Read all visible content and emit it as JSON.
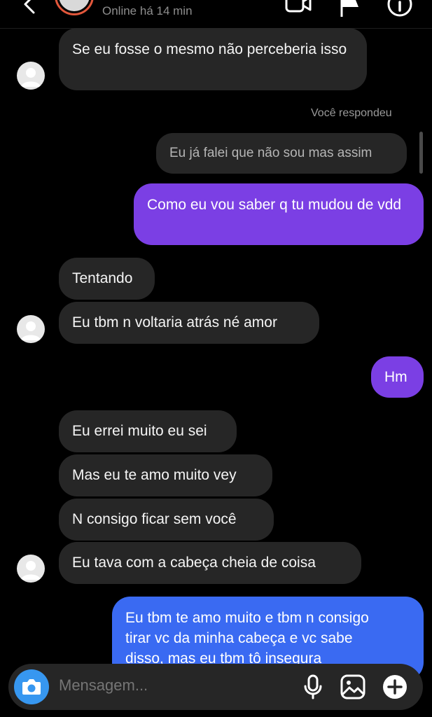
{
  "header": {
    "status": "Online há 14 min"
  },
  "messages": {
    "m1": "Se eu fosse o mesmo não perceberia isso",
    "reply_label": "Você respondeu",
    "reply_quote": "Eu já falei que não sou mas assim",
    "m2": "Como eu vou saber q tu mudou de vdd",
    "m3": "Tentando",
    "m4": "Eu tbm n voltaria atrás né amor",
    "m5": "Hm",
    "m6": "Eu errei muito eu sei",
    "m7": "Mas eu te amo muito vey",
    "m8": "N consigo ficar sem você",
    "m9": "Eu tava com a cabeça cheia de coisa",
    "m10_line1": "Eu tbm te amo muito e tbm n consigo",
    "m10_line2": "tirar vc da minha cabeça e vc sabe",
    "m10_line3": "disso, mas eu tbm tô insegura"
  },
  "composer": {
    "placeholder": "Mensagem..."
  },
  "colors": {
    "bg": "#000000",
    "incoming": "#262626",
    "outgoing_purple": "#7b3fe4",
    "outgoing_blue": "#3a6af2",
    "camera": "#3797f0",
    "story_ring": "#e2573b"
  },
  "icons": [
    "back-icon",
    "video-call-icon",
    "flag-icon",
    "info-icon",
    "camera-icon",
    "microphone-icon",
    "gallery-icon",
    "add-icon"
  ]
}
